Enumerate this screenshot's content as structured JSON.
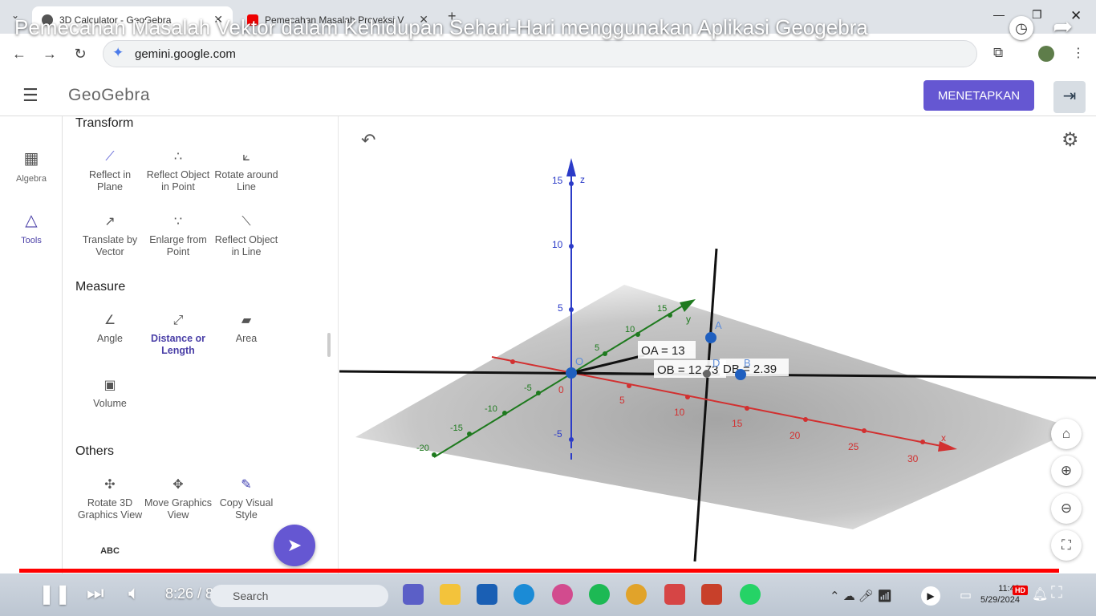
{
  "browser": {
    "tabs": [
      {
        "title": "3D Calculator - GeoGebra"
      },
      {
        "title": "Pemecahan Masalah Proyeksi V"
      }
    ],
    "url": "gemini.google.com"
  },
  "video": {
    "title": "Pemecahan Masalah Vektor dalam Kehidupan Sehari-Hari menggunakan Aplikasi Geogebra",
    "time": "8:26 / 8:35",
    "progress": 0.983,
    "hd_badge": "HD"
  },
  "geogebra": {
    "logo": "GeoGebra",
    "set_button": "MENETAPKAN",
    "rail": [
      {
        "label": "Algebra",
        "icon": "calculator-icon"
      },
      {
        "label": "Tools",
        "icon": "tools-icon",
        "active": true
      }
    ],
    "sections": [
      {
        "title": "Transform",
        "tools": [
          {
            "label": "Reflect in Plane",
            "icon": "reflect-plane-icon"
          },
          {
            "label": "Reflect Object in Point",
            "icon": "reflect-point-icon"
          },
          {
            "label": "Rotate around Line",
            "icon": "rotate-line-icon"
          },
          {
            "label": "Translate by Vector",
            "icon": "translate-vector-icon"
          },
          {
            "label": "Enlarge from Point",
            "icon": "enlarge-icon"
          },
          {
            "label": "Reflect Object in Line",
            "icon": "reflect-line-icon"
          }
        ]
      },
      {
        "title": "Measure",
        "tools": [
          {
            "label": "Angle",
            "icon": "angle-icon"
          },
          {
            "label": "Distance or Length",
            "icon": "distance-icon",
            "active": true
          },
          {
            "label": "Area",
            "icon": "area-icon"
          },
          {
            "label": "Volume",
            "icon": "volume-icon"
          }
        ]
      },
      {
        "title": "Others",
        "tools": [
          {
            "label": "Rotate 3D Graphics View",
            "icon": "rotate-3d-icon"
          },
          {
            "label": "Move Graphics View",
            "icon": "move-view-icon"
          },
          {
            "label": "Copy Visual Style",
            "icon": "brush-icon"
          },
          {
            "label": "ABC",
            "icon": "text-icon"
          }
        ]
      }
    ],
    "graphics": {
      "axis_ticks": {
        "z": [
          "15",
          "10",
          "5",
          "-5"
        ],
        "x": [
          "5",
          "10",
          "15",
          "20",
          "25",
          "30"
        ],
        "y": [
          "5",
          "10",
          "15",
          "-5",
          "-10",
          "-15",
          "-20"
        ],
        "origin": "0"
      },
      "axis_labels": {
        "x": "x",
        "y": "y",
        "z": "z"
      },
      "points": {
        "origin": "O",
        "A": "A",
        "B": "B",
        "D": "D"
      },
      "measure_labels": {
        "OA": "OA = 13",
        "OB": "OB = 12.73",
        "DB": "DB = 2.39"
      },
      "colors": {
        "x_axis": "#d23030",
        "y_axis": "#1e7a1e",
        "z_axis": "#2b3bc8",
        "point": "#1f5fbf"
      }
    }
  },
  "taskbar": {
    "search": "Search",
    "clock_time": "11:48",
    "clock_date": "5/29/2024"
  }
}
